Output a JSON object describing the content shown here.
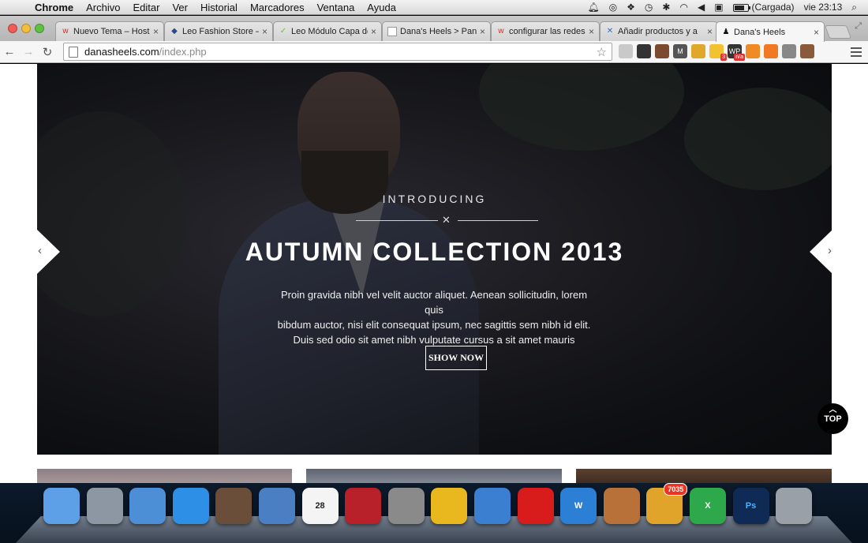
{
  "menubar": {
    "app_name": "Chrome",
    "menus": [
      "Archivo",
      "Editar",
      "Ver",
      "Historial",
      "Marcadores",
      "Ventana",
      "Ayuda"
    ],
    "battery_status": "(Cargada)",
    "clock": "vie 23:13"
  },
  "tabs": [
    {
      "title": "Nuevo Tema – Hosti",
      "favicon": "w",
      "favicon_color": "#d9281f",
      "active": false
    },
    {
      "title": "Leo Fashion Store –",
      "favicon": "◆",
      "favicon_color": "#2b4b8f",
      "active": false
    },
    {
      "title": "Leo Módulo Capa de",
      "favicon": "✓",
      "favicon_color": "#6fbd3f",
      "active": false
    },
    {
      "title": "Dana's Heels > Pane",
      "favicon": "",
      "favicon_color": "#ffffff",
      "active": false
    },
    {
      "title": "configurar las redes",
      "favicon": "w",
      "favicon_color": "#d9281f",
      "active": false
    },
    {
      "title": "Añadir productos y a",
      "favicon": "✕",
      "favicon_color": "#3a6db5",
      "active": false
    },
    {
      "title": "Dana's Heels",
      "favicon": "♟",
      "favicon_color": "#111111",
      "active": true
    }
  ],
  "address_bar": {
    "domain": "danasheels.com",
    "path": "/index.php"
  },
  "extensions": [
    {
      "name": "printer-icon",
      "color": "#c9c9c9",
      "label": ""
    },
    {
      "name": "owl-icon",
      "color": "#333333",
      "label": ""
    },
    {
      "name": "eyedropper-icon",
      "color": "#7b4a2f",
      "label": ""
    },
    {
      "name": "m-icon",
      "color": "#555555",
      "label": "M"
    },
    {
      "name": "sun-icon",
      "color": "#e0a82a",
      "label": ""
    },
    {
      "name": "bulb-icon",
      "color": "#f2c230",
      "label": "",
      "badge": "3"
    },
    {
      "name": "wp-icon",
      "color": "#333333",
      "label": "WP",
      "badge": "n/a"
    },
    {
      "name": "chart-icon",
      "color": "#f08a24",
      "label": ""
    },
    {
      "name": "zigzag-icon",
      "color": "#f07a24",
      "label": ""
    },
    {
      "name": "satellite-icon",
      "color": "#888888",
      "label": ""
    },
    {
      "name": "instagram-icon",
      "color": "#8a5a3c",
      "label": ""
    }
  ],
  "slide": {
    "intro": "INTRODUCING",
    "headline": "AUTUMN COLLECTION 2013",
    "body_lines": [
      "Proin gravida nibh vel velit auctor aliquet. Aenean sollicitudin, lorem quis",
      "bibdum auctor, nisi elit consequat ipsum, nec sagittis sem nibh id elit.",
      "Duis sed odio sit amet nibh vulputate cursus a sit amet mauris"
    ],
    "cta_label": "SHOW NOW",
    "prev_arrow": "‹",
    "next_arrow": "›"
  },
  "back_to_top": {
    "label": "TOP",
    "chevron": "︿"
  },
  "dock": [
    {
      "name": "finder-icon",
      "color": "#5ea0e8",
      "label": ""
    },
    {
      "name": "launchpad-icon",
      "color": "#8d96a3",
      "label": ""
    },
    {
      "name": "alarm-clock-icon",
      "color": "#4d8fd6",
      "label": ""
    },
    {
      "name": "itunes-icon",
      "color": "#2d8fe6",
      "label": ""
    },
    {
      "name": "photo-icon",
      "color": "#6b4e3a",
      "label": ""
    },
    {
      "name": "stamp-icon",
      "color": "#4a7fc4",
      "label": ""
    },
    {
      "name": "calendar-icon",
      "color": "#f4f4f4",
      "label": "28",
      "label_color": "#222222"
    },
    {
      "name": "photobooth-icon",
      "color": "#b8202a",
      "label": ""
    },
    {
      "name": "system-preferences-icon",
      "color": "#8a8a8a",
      "label": ""
    },
    {
      "name": "chrome-icon",
      "color": "#e9b81f",
      "label": ""
    },
    {
      "name": "download-globe-icon",
      "color": "#3a7fd0",
      "label": ""
    },
    {
      "name": "acrobat-icon",
      "color": "#d81b1b",
      "label": ""
    },
    {
      "name": "word-icon",
      "color": "#2b7fd4",
      "label": "W"
    },
    {
      "name": "iphoto-icon",
      "color": "#b9713a",
      "label": ""
    },
    {
      "name": "mail-icon",
      "color": "#e0a42a",
      "label": "",
      "badge": "7035"
    },
    {
      "name": "excel-icon",
      "color": "#2da84b",
      "label": "X"
    },
    {
      "name": "photoshop-icon",
      "color": "#0f2a55",
      "label": "Ps",
      "label_color": "#4ab3ff"
    },
    {
      "name": "trash-icon",
      "color": "#9aa0a8",
      "label": ""
    }
  ]
}
